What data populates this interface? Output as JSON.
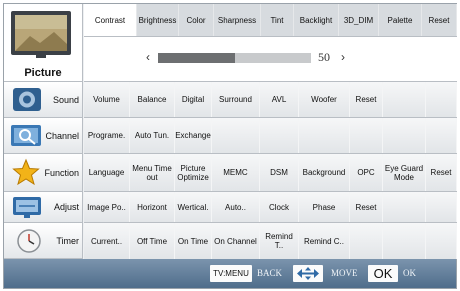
{
  "categories": {
    "picture": "Picture",
    "sound": "Sound",
    "channel": "Channel",
    "function": "Function",
    "adjust": "Adjust",
    "timer": "Timer"
  },
  "tabs": [
    "Contrast",
    "Brightness",
    "Color",
    "Sharpness",
    "Tint",
    "Backlight",
    "3D_DIM",
    "Palette",
    "Reset"
  ],
  "slider": {
    "left": "‹",
    "right": "›",
    "value": "50",
    "level": 0.5
  },
  "rows": {
    "sound": [
      "Volume",
      "Balance",
      "Digital",
      "Surround",
      "AVL",
      "Woofer",
      "Reset",
      "",
      ""
    ],
    "channel": [
      "Programe.",
      "Auto Tun.",
      "Exchange",
      "",
      "",
      "",
      "",
      "",
      ""
    ],
    "function": [
      "Language",
      "Menu Time out",
      "Picture Optimize",
      "MEMC",
      "DSM",
      "Background",
      "OPC",
      "Eye Guard Mode",
      "Reset"
    ],
    "adjust": [
      "Image Po..",
      "Horizont",
      "Wertical.",
      "Auto..",
      "Clock",
      "Phase",
      "Reset",
      "",
      ""
    ],
    "timer": [
      "Current..",
      "Off Time",
      "On Time",
      "On Channel",
      "Remind T..",
      "Remind C..",
      "",
      "",
      ""
    ]
  },
  "bottom": {
    "tvmenu_key": "TV:MENU",
    "back_label": "BACK",
    "move_label": "MOVE",
    "ok_key": "OK",
    "ok_label": "OK"
  },
  "colors": {
    "bottom_bar": "#5d7a97",
    "slider_fill": "#6d6f71",
    "slider_track": "#c8cacc"
  }
}
